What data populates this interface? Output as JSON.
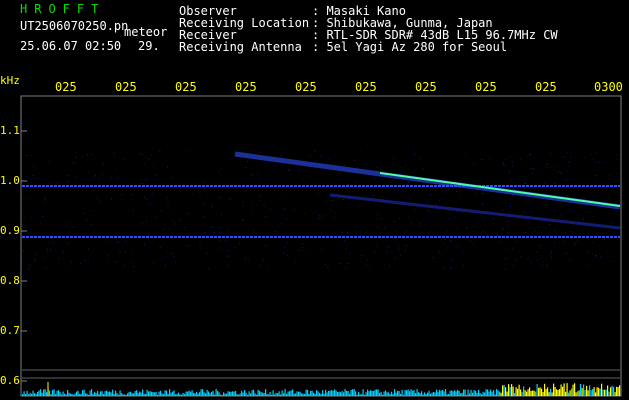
{
  "header": {
    "logo": "HROFFT",
    "filename": "UT2506070250.pn",
    "datetime": "25.06.07 02:50",
    "meteor_label": "meteor",
    "meteor_count": "29.",
    "fields": [
      {
        "label": "Observer",
        "value": ": Masaki Kano"
      },
      {
        "label": "Receiving Location",
        "value": ": Shibukawa, Gunma, Japan"
      },
      {
        "label": "Receiver",
        "value": ": RTL-SDR SDR# 43dB L15 96.7MHz CW"
      },
      {
        "label": "Receiving Antenna",
        "value": ": 5el Yagi Az 280 for Seoul"
      }
    ]
  },
  "time_axis": {
    "ticks": [
      "025",
      "025",
      "025",
      "025",
      "025",
      "025",
      "025",
      "025",
      "025",
      "0300"
    ]
  },
  "freq_axis": {
    "unit": "kHz",
    "ticks": [
      "1.1",
      "1.0",
      "0.9",
      "0.8",
      "0.7",
      "0.6"
    ]
  },
  "colors": {
    "background": "#000000",
    "text": "#ffffff",
    "logo": "#00e000",
    "axis_labels": "#ffff00",
    "frame": "#808080",
    "signal": "#3050ff",
    "meteor_core": "#50ffa0",
    "level_bar": "#00d0ff",
    "level_bar_high": "#ffff00"
  }
}
